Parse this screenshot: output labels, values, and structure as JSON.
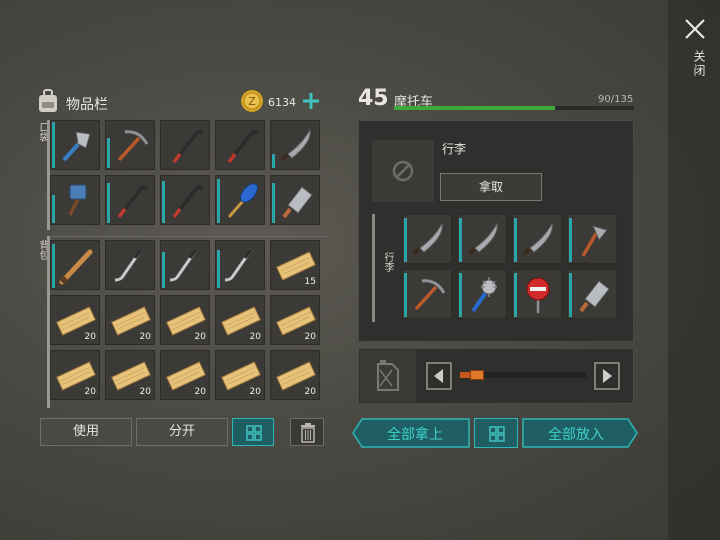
{
  "close": {
    "label": "关闭"
  },
  "inventory": {
    "title": "物品栏",
    "coins": "6134",
    "pocket_label": "口袋",
    "backpack_label": "背包",
    "pocket_slots": [
      {
        "icon": "axe-icon",
        "qty": ""
      },
      {
        "icon": "pickaxe-icon",
        "qty": ""
      },
      {
        "icon": "crowbar-icon",
        "qty": ""
      },
      {
        "icon": "crowbar-icon",
        "qty": ""
      },
      {
        "icon": "machete-icon",
        "qty": ""
      },
      {
        "icon": "sledgehammer-icon",
        "qty": ""
      },
      {
        "icon": "crowbar-icon",
        "qty": ""
      },
      {
        "icon": "crowbar-icon",
        "qty": ""
      },
      {
        "icon": "paddle-icon",
        "qty": ""
      },
      {
        "icon": "cleaver-icon",
        "qty": ""
      }
    ],
    "backpack_slots": [
      {
        "icon": "baseball-bat-icon",
        "qty": ""
      },
      {
        "icon": "hockey-stick-icon",
        "qty": ""
      },
      {
        "icon": "hockey-stick-icon",
        "qty": ""
      },
      {
        "icon": "hockey-stick-icon",
        "qty": ""
      },
      {
        "icon": "wood-plank-icon",
        "qty": "15"
      },
      {
        "icon": "wood-plank-icon",
        "qty": "20"
      },
      {
        "icon": "wood-plank-icon",
        "qty": "20"
      },
      {
        "icon": "wood-plank-icon",
        "qty": "20"
      },
      {
        "icon": "wood-plank-icon",
        "qty": "20"
      },
      {
        "icon": "wood-plank-icon",
        "qty": "20"
      },
      {
        "icon": "wood-plank-icon",
        "qty": "20"
      },
      {
        "icon": "wood-plank-icon",
        "qty": "20"
      },
      {
        "icon": "wood-plank-icon",
        "qty": "20"
      },
      {
        "icon": "wood-plank-icon",
        "qty": "20"
      },
      {
        "icon": "wood-plank-icon",
        "qty": "20"
      }
    ],
    "buttons": {
      "use": "使用",
      "split": "分开"
    }
  },
  "vehicle": {
    "level": "45",
    "name": "摩托车",
    "capacity": "90/135",
    "capacity_fraction": 0.67,
    "storage_title": "行李",
    "take_label": "拿取",
    "luggage_label": "行李",
    "luggage_slots": [
      {
        "icon": "machete-icon"
      },
      {
        "icon": "machete-icon"
      },
      {
        "icon": "machete-icon"
      },
      {
        "icon": "hatchet-icon"
      },
      {
        "icon": "pickaxe-icon"
      },
      {
        "icon": "spiked-club-icon"
      },
      {
        "icon": "stop-sign-icon"
      },
      {
        "icon": "cleaver-icon"
      }
    ],
    "fuel_fraction": 0.17
  },
  "actions": {
    "take_all": "全部拿上",
    "put_all": "全部放入"
  },
  "colors": {
    "accent": "#2fb6b8",
    "capacity_bar": "#3fa83a",
    "fuel": "#c9571f"
  }
}
